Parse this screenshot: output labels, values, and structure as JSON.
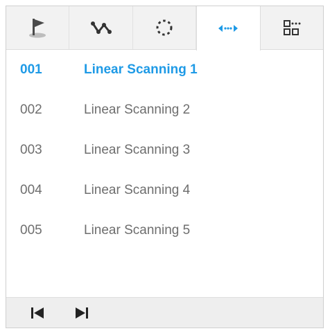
{
  "tabs": [
    {
      "id": "preset",
      "icon": "flag-icon",
      "active": false
    },
    {
      "id": "tour",
      "icon": "tour-path-icon",
      "active": false
    },
    {
      "id": "pattern",
      "icon": "dotted-circle-icon",
      "active": false
    },
    {
      "id": "linear-scan",
      "icon": "left-right-arrows-icon",
      "active": true
    },
    {
      "id": "more",
      "icon": "grid-more-icon",
      "active": false
    }
  ],
  "items": [
    {
      "num": "001",
      "name": "Linear Scanning 1",
      "selected": true
    },
    {
      "num": "002",
      "name": "Linear Scanning 2",
      "selected": false
    },
    {
      "num": "003",
      "name": "Linear Scanning 3",
      "selected": false
    },
    {
      "num": "004",
      "name": "Linear Scanning 4",
      "selected": false
    },
    {
      "num": "005",
      "name": "Linear Scanning 5",
      "selected": false
    }
  ],
  "footer": {
    "first_icon": "skip-first-icon",
    "last_icon": "skip-last-icon"
  },
  "colors": {
    "accent": "#1e9ae6",
    "text": "#6e6e6e",
    "icon": "#333333"
  }
}
